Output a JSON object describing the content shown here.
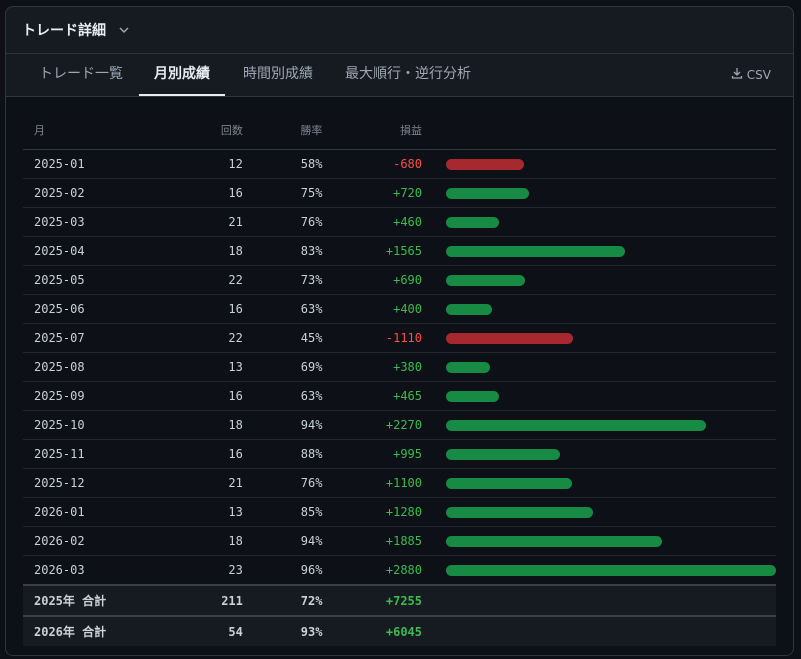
{
  "header": {
    "title": "トレード詳細"
  },
  "tabs": [
    {
      "label": "トレード一覧"
    },
    {
      "label": "月別成績"
    },
    {
      "label": "時間別成績"
    },
    {
      "label": "最大順行・逆行分析"
    }
  ],
  "toolbar": {
    "csv_label": "CSV"
  },
  "table": {
    "columns": {
      "month": "月",
      "count": "回数",
      "rate": "勝率",
      "pnl": "損益"
    },
    "rows": [
      {
        "month": "2025-01",
        "count": "12",
        "rate": "58%",
        "pnl": "-680",
        "value": -680
      },
      {
        "month": "2025-02",
        "count": "16",
        "rate": "75%",
        "pnl": "+720",
        "value": 720
      },
      {
        "month": "2025-03",
        "count": "21",
        "rate": "76%",
        "pnl": "+460",
        "value": 460
      },
      {
        "month": "2025-04",
        "count": "18",
        "rate": "83%",
        "pnl": "+1565",
        "value": 1565
      },
      {
        "month": "2025-05",
        "count": "22",
        "rate": "73%",
        "pnl": "+690",
        "value": 690
      },
      {
        "month": "2025-06",
        "count": "16",
        "rate": "63%",
        "pnl": "+400",
        "value": 400
      },
      {
        "month": "2025-07",
        "count": "22",
        "rate": "45%",
        "pnl": "-1110",
        "value": -1110
      },
      {
        "month": "2025-08",
        "count": "13",
        "rate": "69%",
        "pnl": "+380",
        "value": 380
      },
      {
        "month": "2025-09",
        "count": "16",
        "rate": "63%",
        "pnl": "+465",
        "value": 465
      },
      {
        "month": "2025-10",
        "count": "18",
        "rate": "94%",
        "pnl": "+2270",
        "value": 2270
      },
      {
        "month": "2025-11",
        "count": "16",
        "rate": "88%",
        "pnl": "+995",
        "value": 995
      },
      {
        "month": "2025-12",
        "count": "21",
        "rate": "76%",
        "pnl": "+1100",
        "value": 1100
      },
      {
        "month": "2026-01",
        "count": "13",
        "rate": "85%",
        "pnl": "+1280",
        "value": 1280
      },
      {
        "month": "2026-02",
        "count": "18",
        "rate": "94%",
        "pnl": "+1885",
        "value": 1885
      },
      {
        "month": "2026-03",
        "count": "23",
        "rate": "96%",
        "pnl": "+2880",
        "value": 2880
      }
    ],
    "totals": [
      {
        "label": "2025年 合計",
        "count": "211",
        "rate": "72%",
        "pnl": "+7255"
      },
      {
        "label": "2026年 合計",
        "count": "54",
        "rate": "93%",
        "pnl": "+6045"
      }
    ]
  },
  "colors": {
    "positive": "#3fb950",
    "negative": "#f85149",
    "positive_bar": "#178a43",
    "negative_bar": "#a8282f"
  },
  "icons": {
    "header_toggle": "chevron-down-icon",
    "csv": "download-icon"
  }
}
